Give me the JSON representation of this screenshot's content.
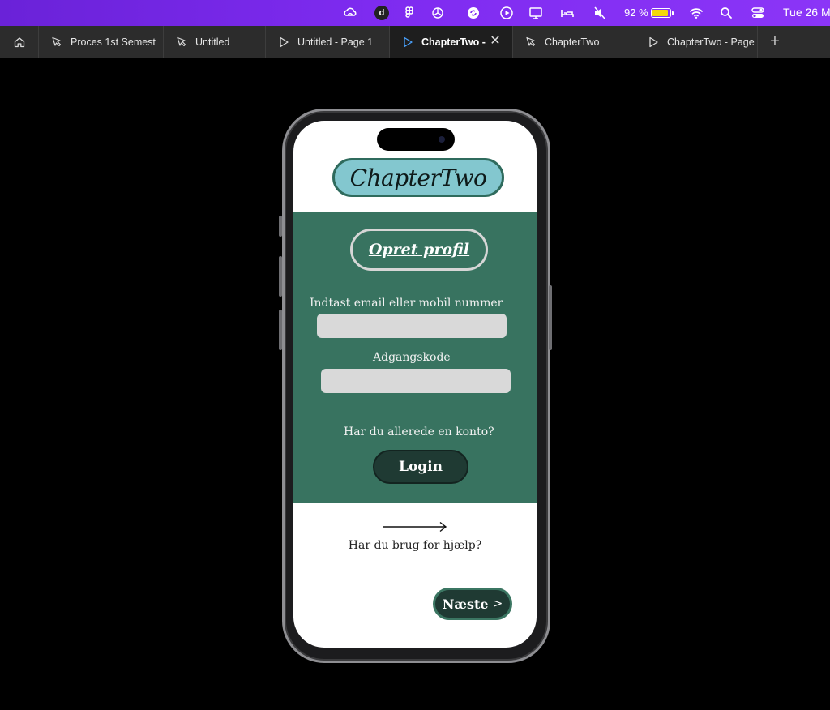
{
  "menubar": {
    "icons": [
      "creative-cloud-icon",
      "d-app-icon",
      "figma-icon",
      "chatgpt-icon",
      "sync-icon",
      "play-icon",
      "display-icon",
      "bed-icon",
      "mute-icon",
      "wifi-icon",
      "search-icon",
      "control-center-icon"
    ],
    "d_app_letter": "d",
    "battery_percent": "92 %",
    "battery_level": 0.92,
    "clock": "Tue 26 M"
  },
  "tabs": [
    {
      "label": "Proces 1st Semest",
      "icon": "figma-file-icon",
      "active": false
    },
    {
      "label": "Untitled",
      "icon": "figma-file-icon",
      "active": false
    },
    {
      "label": "Untitled - Page 1",
      "icon": "prototype-play-icon",
      "active": false
    },
    {
      "label": "ChapterTwo -",
      "icon": "prototype-play-icon",
      "active": true
    },
    {
      "label": "ChapterTwo",
      "icon": "figma-file-icon",
      "active": false
    },
    {
      "label": "ChapterTwo - Page",
      "icon": "prototype-play-icon",
      "active": false
    }
  ],
  "tab_close_glyph": "✕",
  "tab_add_glyph": "+",
  "app": {
    "logo_text": "ChapterTwo",
    "create_profile": "Opret profil",
    "email_label": "Indtast email eller mobil nummer",
    "email_value": "",
    "password_label": "Adgangskode",
    "password_value": "",
    "have_account": "Har du allerede en konto?",
    "login_button": "Login",
    "help_link": "Har du brug for hjælp?",
    "next_button": "Næste",
    "next_chevron": ">"
  },
  "colors": {
    "menubar_accent": "#7e2bf0",
    "logo_pill": "#83c7cf",
    "panel_green": "#387360",
    "button_dark": "#1f3a33",
    "battery_yellow": "#f5d90b"
  }
}
